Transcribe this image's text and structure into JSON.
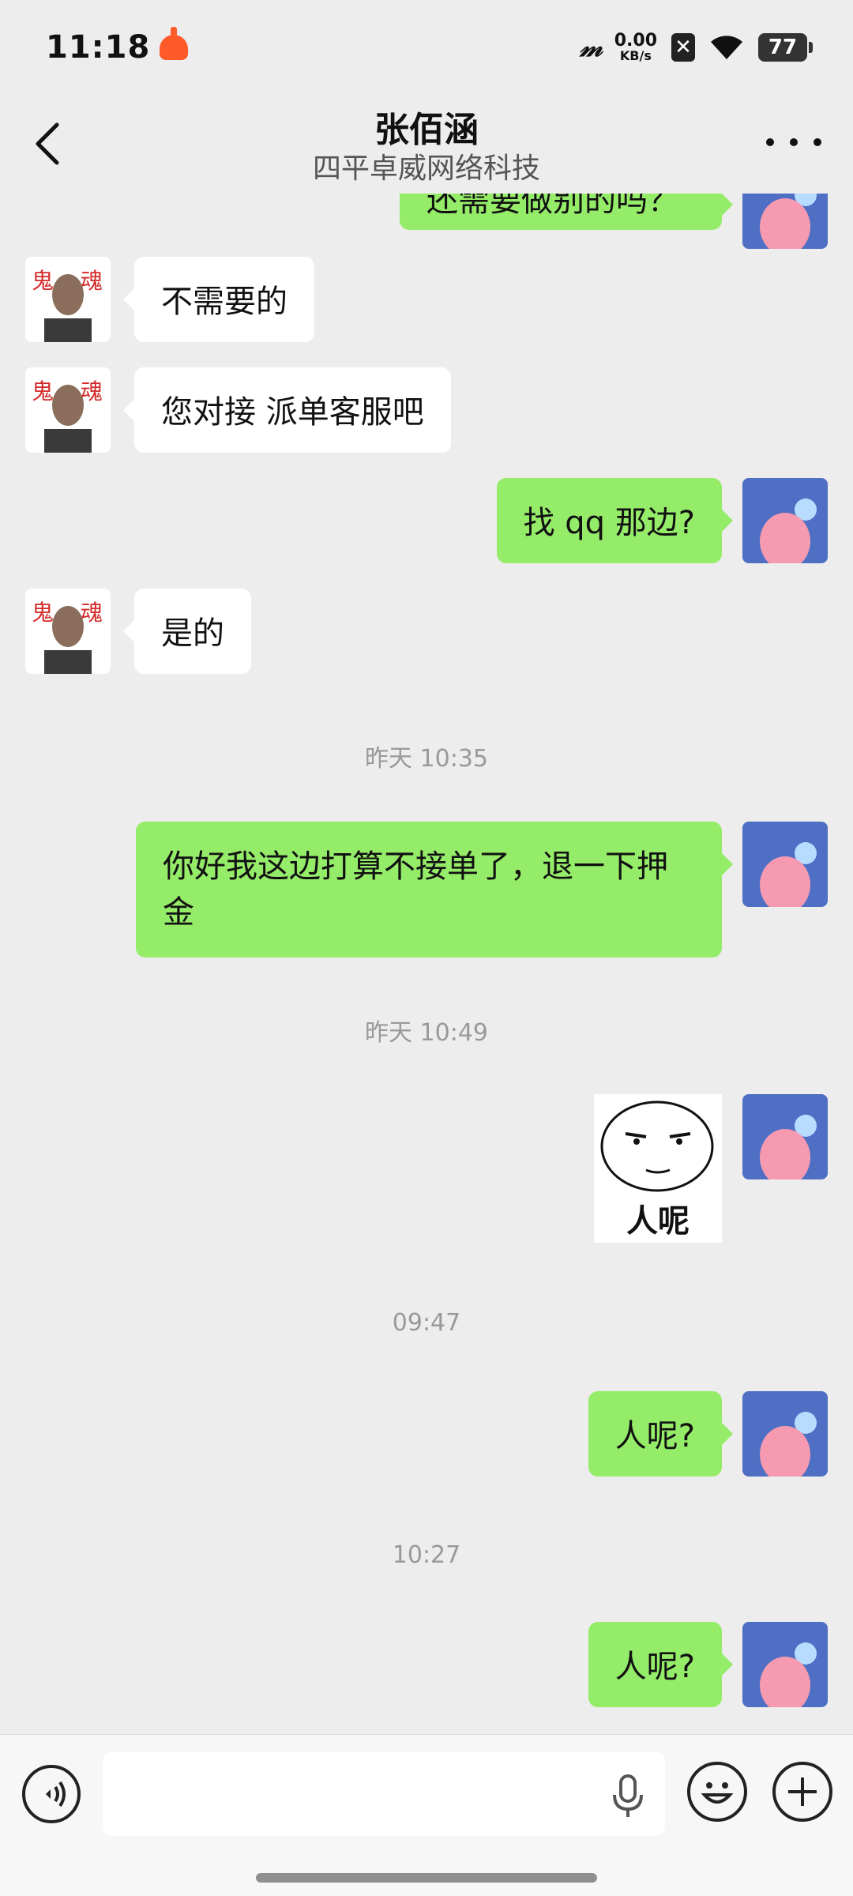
{
  "status_bar": {
    "time": "11:18",
    "signal": "ᵐ",
    "speed_value": "0.00",
    "speed_unit": "KB/s",
    "battery": "77"
  },
  "header": {
    "title": "张佰涵",
    "subtitle": "四平卓威网络科技"
  },
  "messages": [
    {
      "side": "out",
      "text": "还需要做别的吗？"
    },
    {
      "side": "in",
      "text": "不需要的"
    },
    {
      "side": "in",
      "text": "您对接 派单客服吧"
    },
    {
      "side": "out",
      "text": "找 qq 那边?"
    },
    {
      "side": "in",
      "text": "是的"
    },
    {
      "side": "out",
      "text": "你好我这边打算不接单了，退一下押金"
    },
    {
      "side": "out",
      "sticker_text": "人呢"
    },
    {
      "side": "out",
      "text": "人呢?"
    },
    {
      "side": "out",
      "text": "人呢?"
    }
  ],
  "timestamps": [
    "昨天 10:35",
    "昨天 10:49",
    "09:47",
    "10:27"
  ],
  "icons": {
    "back": "chevron-left-icon",
    "more": "more-dots-icon",
    "voice": "voice-icon",
    "mic": "mic-icon",
    "emoji": "emoji-icon",
    "plus": "plus-icon"
  },
  "colors": {
    "outgoing_bubble": "#95ec69",
    "incoming_bubble": "#ffffff",
    "background": "#ededed"
  }
}
